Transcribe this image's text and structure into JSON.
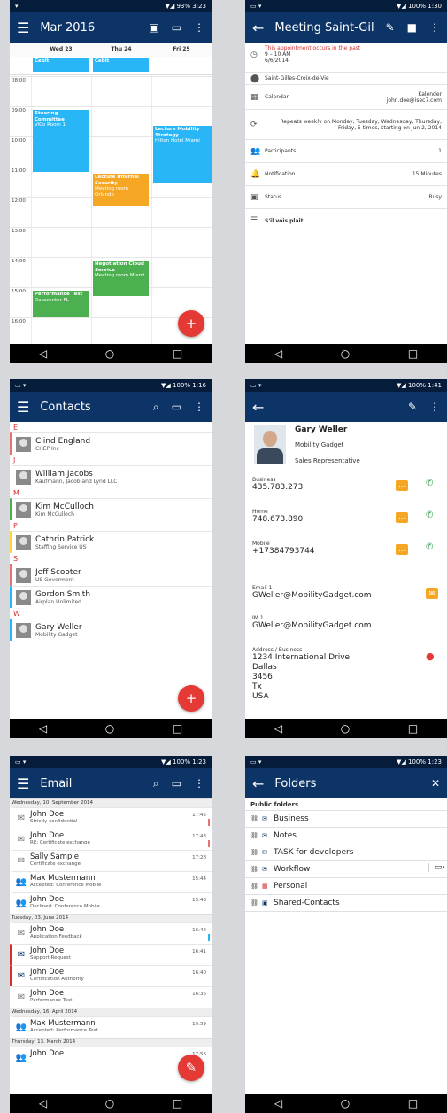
{
  "calendar": {
    "status_time": "3:23",
    "status_battery": "93%",
    "title": "Mar 2016",
    "days": [
      "Wed 23",
      "Thu 24",
      "Fri 25"
    ],
    "hours": [
      "08:00",
      "09:00",
      "10:00",
      "11:00",
      "12:00",
      "13:00",
      "14:00",
      "15:00",
      "16:00"
    ],
    "allday": [
      {
        "label": "Cebit"
      },
      {
        "label": "Cebit"
      }
    ],
    "events": [
      {
        "title": "Steering Committee",
        "loc": "ViCo Room 1"
      },
      {
        "title": "Lecture Mobility Strategy",
        "loc": "Hilton Hotel Miami"
      },
      {
        "title": "Lecture Internal Security",
        "loc": "Meeting room Orlando"
      },
      {
        "title": "Negotiation Cloud Service",
        "loc": "Meeting room Miami"
      },
      {
        "title": "Performance Test",
        "loc": "Datacenter FL"
      }
    ],
    "fab": "+",
    "colors": {
      "blue": "#29b6f6",
      "orange": "#f5a623",
      "green": "#4caf50"
    }
  },
  "meeting": {
    "status_time": "1:30",
    "status_battery": "100%",
    "title": "Meeting Saint-Gilles-...",
    "past_warning": "This appointment occurs in the past",
    "time": "9 – 10 AM",
    "date": "6/6/2014",
    "location": "Saint-Gilles-Croix-de-Vie",
    "calendar_label": "Calendar",
    "calendar_name": "Kalender",
    "calendar_email": "john.doe@isec7.com",
    "repeat": "Repeats weekly on Monday, Tuesday, Wednesday, Thursday, Friday, 5 times, starting on Jun 2, 2014",
    "participants_label": "Participants",
    "participants_count": "1",
    "notification_label": "Notification",
    "notification_value": "15 Minutes",
    "status_label": "Status",
    "status_value": "Busy",
    "note": "S'il vois plait."
  },
  "contacts": {
    "status_time": "1:16",
    "status_battery": "100%",
    "title": "Contacts",
    "groups": [
      {
        "letter": "E",
        "items": [
          {
            "name": "Clind England",
            "company": "CHEP Inc",
            "color": "#e57373"
          }
        ]
      },
      {
        "letter": "J",
        "items": [
          {
            "name": "William Jacobs",
            "company": "Kaufmann, Jacob and Lynd LLC",
            "color": "#ffffff"
          }
        ]
      },
      {
        "letter": "M",
        "items": [
          {
            "name": "Kim McCulloch",
            "company": "Kim McCulloch",
            "color": "#4caf50"
          }
        ]
      },
      {
        "letter": "P",
        "items": [
          {
            "name": "Cathrin Patrick",
            "company": "Staffing Service US",
            "color": "#fdd835"
          }
        ]
      },
      {
        "letter": "S",
        "items": [
          {
            "name": "Jeff Scooter",
            "company": "US Goverment",
            "color": "#e57373"
          },
          {
            "name": "Gordon Smith",
            "company": "Airplan Unlimited",
            "color": "#29b6f6"
          }
        ]
      },
      {
        "letter": "W",
        "items": [
          {
            "name": "Gary Weller",
            "company": "Mobility Gadget",
            "color": "#29b6f6"
          }
        ]
      }
    ],
    "fab": "+"
  },
  "contact_detail": {
    "status_time": "1:41",
    "status_battery": "100%",
    "name": "Gary Weller",
    "company": "Mobility Gadget",
    "job": "Sales Representative",
    "business_label": "Business",
    "business": "435.783.273",
    "home_label": "Home",
    "home": "748.673.890",
    "mobile_label": "Mobile",
    "mobile": "+17384793744",
    "email_label": "Email 1",
    "email": "GWeller@MobilityGadget.com",
    "im_label": "IM 1",
    "im": "GWeller@MobilityGadget.com",
    "address_label": "Address / Business",
    "address": [
      "1234  International Drive",
      "Dallas",
      "3456",
      "Tx",
      "USA"
    ]
  },
  "email": {
    "status_time": "1:23",
    "status_battery": "100%",
    "title": "Email",
    "sections": [
      {
        "date": "Wednesday, 10. September 2014",
        "items": [
          {
            "from": "John Doe",
            "subject": "Strictly confidential",
            "time": "17:45",
            "icon": "open",
            "flag": "#e57373"
          },
          {
            "from": "John Doe",
            "subject": "RE: Certificate exchange",
            "time": "17:43",
            "icon": "open",
            "flag": "#e57373"
          },
          {
            "from": "Sally Sample",
            "subject": "Certificate exchange",
            "time": "17:28",
            "icon": "open",
            "flag": ""
          },
          {
            "from": "Max Mustermann",
            "subject": "Accepted: Conference Mobile",
            "time": "15:44",
            "icon": "people",
            "flag": ""
          },
          {
            "from": "John Doe",
            "subject": "Declined: Conference Mobile",
            "time": "15:43",
            "icon": "people",
            "flag": ""
          }
        ]
      },
      {
        "date": "Tuesday, 03. June 2014",
        "items": [
          {
            "from": "John Doe",
            "subject": "Application Feedback",
            "time": "16:42",
            "icon": "open",
            "flag": "#29b6f6"
          },
          {
            "from": "John Doe",
            "subject": "Support Request",
            "time": "16:41",
            "icon": "closed",
            "flag": ""
          },
          {
            "from": "John Doe",
            "subject": "Certification Authority",
            "time": "16:40",
            "icon": "closed",
            "flag": ""
          },
          {
            "from": "John Doe",
            "subject": "Performance Test",
            "time": "16:36",
            "icon": "open",
            "flag": ""
          }
        ]
      },
      {
        "date": "Wednesday, 16. April 2014",
        "items": [
          {
            "from": "Max Mustermann",
            "subject": "Accepted: Performance Test",
            "time": "19:59",
            "icon": "people",
            "flag": ""
          }
        ]
      },
      {
        "date": "Thursday, 13. March 2014",
        "items": [
          {
            "from": "John Doe",
            "subject": "",
            "time": "17:56",
            "icon": "people",
            "flag": ""
          }
        ]
      }
    ]
  },
  "folders": {
    "status_time": "1:23",
    "status_battery": "100%",
    "title": "Folders",
    "section": "Public folders",
    "items": [
      {
        "name": "Business",
        "icon": "mail"
      },
      {
        "name": "Notes",
        "icon": "mail"
      },
      {
        "name": "TASK for developers",
        "icon": "mail"
      },
      {
        "name": "Workflow",
        "icon": "mail"
      },
      {
        "name": "Personal",
        "icon": "calendar"
      },
      {
        "name": "Shared-Contacts",
        "icon": "contact"
      }
    ]
  }
}
